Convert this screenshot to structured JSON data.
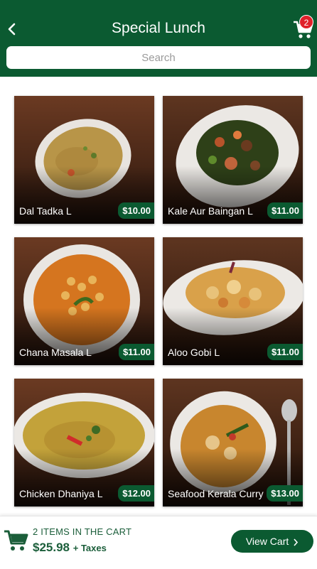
{
  "header": {
    "title": "Special Lunch",
    "cart_count": "2"
  },
  "search": {
    "placeholder": "Search"
  },
  "items": [
    {
      "name": "Dal Tadka L",
      "price": "$10.00"
    },
    {
      "name": "Kale Aur Baingan L",
      "price": "$11.00"
    },
    {
      "name": "Chana Masala L",
      "price": "$11.00"
    },
    {
      "name": "Aloo Gobi L",
      "price": "$11.00"
    },
    {
      "name": "Chicken Dhaniya L",
      "price": "$12.00"
    },
    {
      "name": "Seafood Kerala Curry",
      "price": "$13.00"
    }
  ],
  "footer": {
    "items_text": "2 ITEMS IN THE CART",
    "total": "$25.98",
    "taxes": "+ Taxes",
    "view_cart_label": "View Cart"
  },
  "colors": {
    "brand": "#0b5a31",
    "badge": "#e0202a"
  },
  "icons": {
    "back": "back-arrow-icon",
    "cart": "shopping-cart-icon",
    "chevron": "chevron-right-icon"
  }
}
